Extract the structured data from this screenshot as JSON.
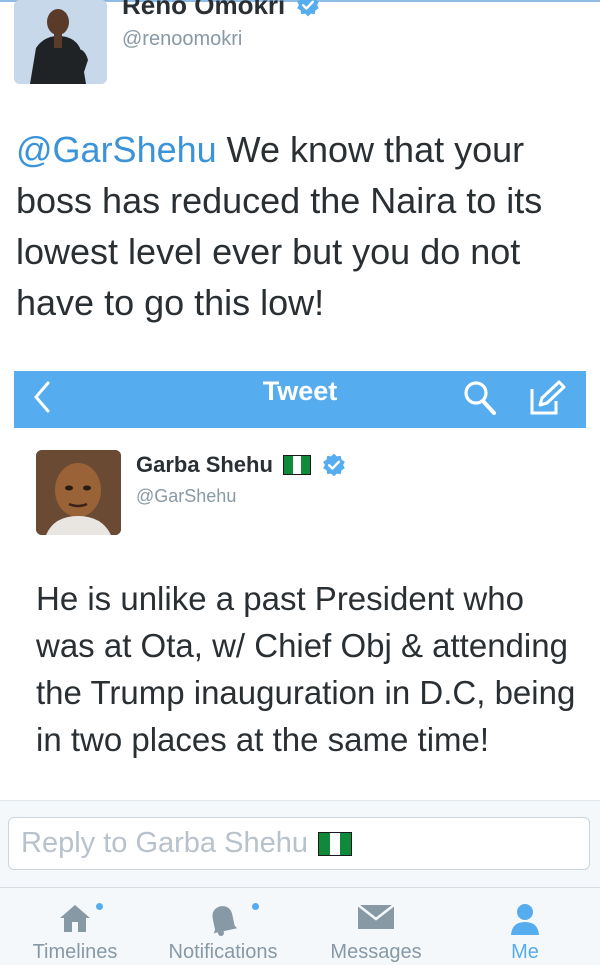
{
  "top_tweet": {
    "name": "Reno Omokri",
    "handle": "@renoomokri",
    "mention": "@GarShehu",
    "text": " We know that your boss has reduced the Naira to its lowest level ever but you do not have to go this low!"
  },
  "inner_nav": {
    "title": "Tweet",
    "back_icon": "chevron-left-icon",
    "search_icon": "search-icon",
    "compose_icon": "compose-icon"
  },
  "inner_tweet": {
    "name": "Garba Shehu",
    "handle": "@GarShehu",
    "text": "He is unlike a past President who was at Ota, w/ Chief Obj & attending the Trump inauguration in D.C, being in two places at the same time!"
  },
  "reply": {
    "placeholder": "Reply to Garba Shehu"
  },
  "tabs": [
    {
      "label": "Timelines",
      "icon": "home-icon",
      "active": false,
      "dot": true
    },
    {
      "label": "Notifications",
      "icon": "bell-icon",
      "active": false,
      "dot": true
    },
    {
      "label": "Messages",
      "icon": "envelope-icon",
      "active": false,
      "dot": false
    },
    {
      "label": "Me",
      "icon": "person-icon",
      "active": true,
      "dot": false
    }
  ],
  "colors": {
    "accent": "#55acee",
    "link": "#3b94d9",
    "text": "#292f33",
    "muted": "#8899a6"
  }
}
